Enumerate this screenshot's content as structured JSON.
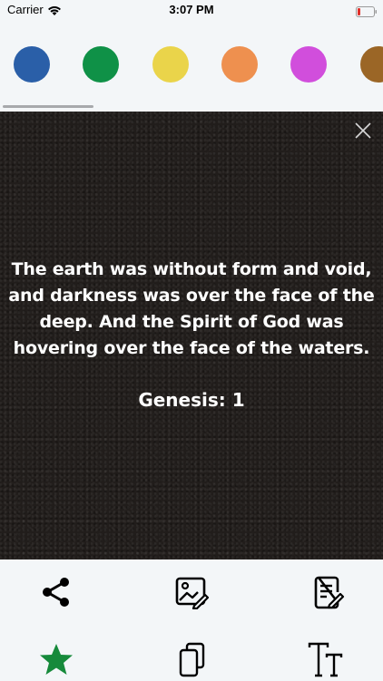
{
  "status_bar": {
    "carrier": "Carrier",
    "time": "3:07 PM"
  },
  "color_swatches": [
    {
      "name": "blue",
      "color": "#2a5fa8"
    },
    {
      "name": "green",
      "color": "#0f9147"
    },
    {
      "name": "yellow",
      "color": "#ead44a"
    },
    {
      "name": "orange",
      "color": "#ee904f"
    },
    {
      "name": "magenta",
      "color": "#d14edc"
    },
    {
      "name": "brown",
      "color": "#9b6626"
    }
  ],
  "verse": {
    "text": "The earth was without form and void, and darkness was over the face of the deep. And the Spirit of God was hovering over the face of the waters.",
    "reference": "Genesis: 1"
  },
  "toolbar": {
    "icons": [
      "share-icon",
      "image-edit-icon",
      "note-edit-icon",
      "star-icon",
      "copy-icon",
      "text-size-icon"
    ],
    "star_color": "#168a3b"
  }
}
